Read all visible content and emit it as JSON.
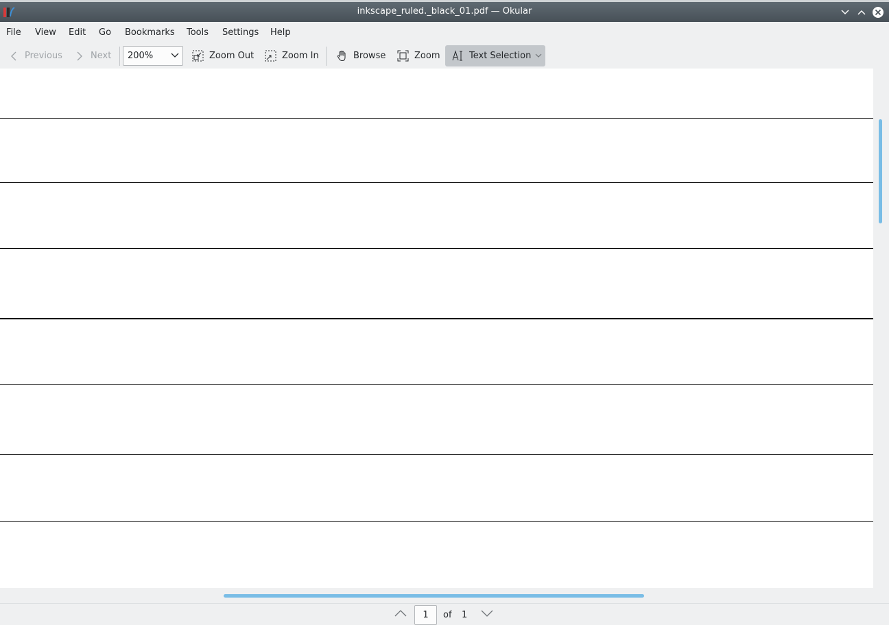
{
  "window": {
    "title": "inkscape_ruled._black_01.pdf — Okular"
  },
  "menu": [
    "File",
    "View",
    "Edit",
    "Go",
    "Bookmarks",
    "Tools",
    "Settings",
    "Help"
  ],
  "toolbar": {
    "previous_label": "Previous",
    "next_label": "Next",
    "zoom_value": "200%",
    "zoom_out_label": "Zoom Out",
    "zoom_in_label": "Zoom In",
    "browse_label": "Browse",
    "zoom_label": "Zoom",
    "text_selection_label": "Text Selection"
  },
  "pager": {
    "current_page": "1",
    "of_label": "of",
    "total_pages": "1"
  },
  "colors": {
    "accent": "#79bde6",
    "titlebar": "#475057",
    "rule_line": "#000000"
  }
}
